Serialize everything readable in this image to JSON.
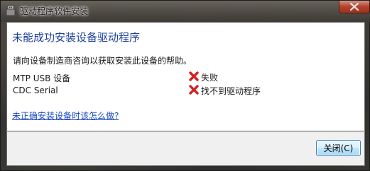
{
  "window": {
    "title": "驱动程序软件安装",
    "close_button_icon": "close-x-icon"
  },
  "main": {
    "heading": "未能成功安装设备驱动程序",
    "instruction": "请向设备制造商咨询以获取安装此设备的帮助。",
    "devices": [
      {
        "name": "MTP USB 设备",
        "status": "失败",
        "status_icon": "error-x-icon"
      },
      {
        "name": "CDC Serial",
        "status": "找不到驱动程序",
        "status_icon": "error-x-icon"
      }
    ],
    "help_link": "未正确安装设备时该怎么做?"
  },
  "footer": {
    "close_label": "关闭(C)"
  },
  "colors": {
    "heading": "#1d3f9a",
    "link": "#1c48c4",
    "error": "#d42020",
    "close_x": "#c7432a"
  }
}
